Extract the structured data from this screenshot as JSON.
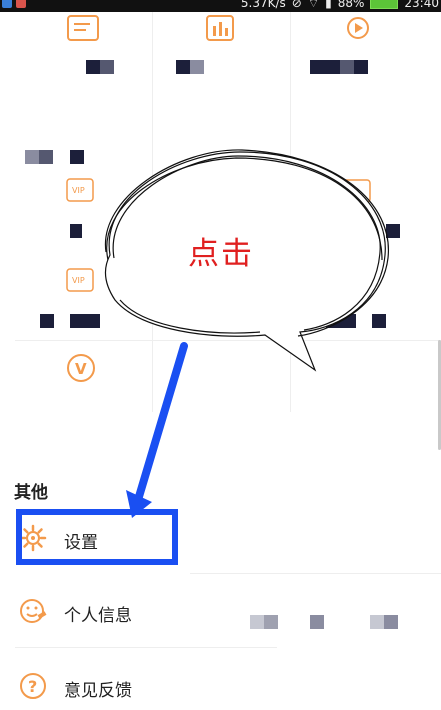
{
  "status_bar": {
    "speed": "5.37K/s",
    "battery": "88%",
    "time": "23:40"
  },
  "callout": {
    "text": "点击"
  },
  "other_section": {
    "title": "其他",
    "items": [
      {
        "label": "设置",
        "icon": "settings-gear-icon"
      },
      {
        "label": "个人信息",
        "icon": "smiley-wrench-icon"
      },
      {
        "label": "意见反馈",
        "icon": "question-icon"
      }
    ]
  },
  "colors": {
    "accent_orange": "#f39a4b",
    "highlight_blue": "#1a4ff2",
    "callout_red": "#e02020"
  }
}
